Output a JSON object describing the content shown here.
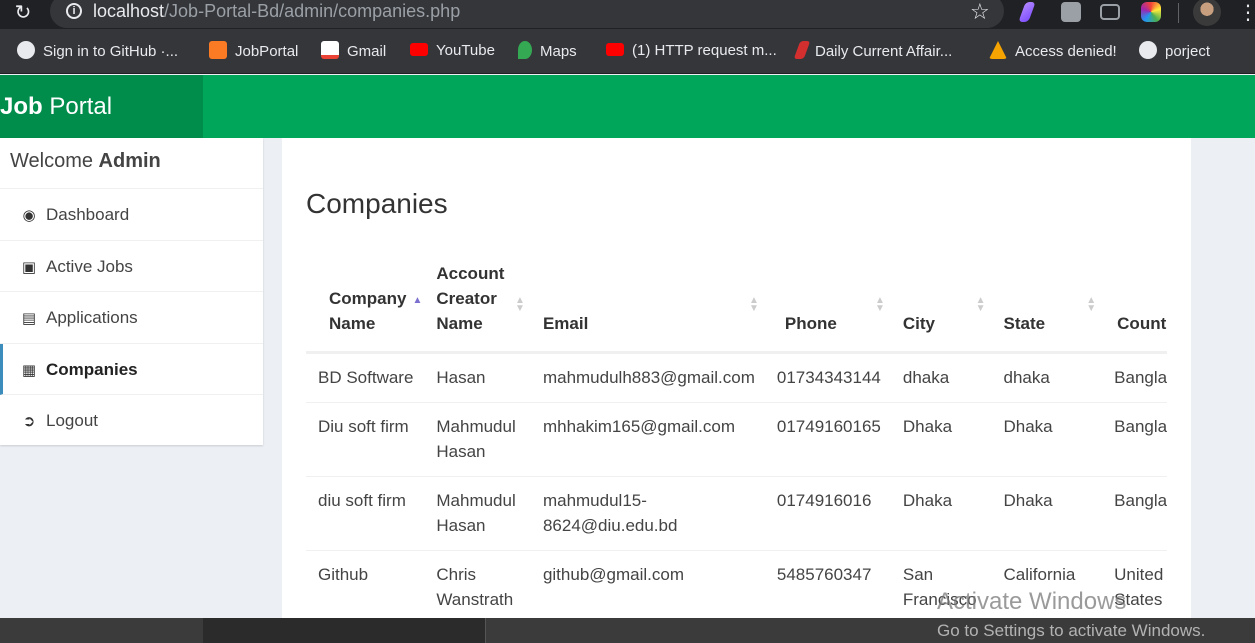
{
  "browser": {
    "url_host": "localhost",
    "url_path": "/Job-Portal-Bd/admin/companies.php",
    "bookmarks": [
      {
        "label": "Sign in to GitHub ·...",
        "icon": "github-icon",
        "color": "#ffffff"
      },
      {
        "label": "JobPortal",
        "icon": "xampp-icon",
        "color": "#fb7a24"
      },
      {
        "label": "Gmail",
        "icon": "gmail-icon",
        "color": "#ea4335"
      },
      {
        "label": "YouTube",
        "icon": "youtube-icon",
        "color": "#ff0000"
      },
      {
        "label": "Maps",
        "icon": "maps-icon",
        "color": "#34a853"
      },
      {
        "label": "(1) HTTP request m...",
        "icon": "youtube-icon",
        "color": "#ff0000"
      },
      {
        "label": "Daily Current Affair...",
        "icon": "daily-icon",
        "color": "#d32f2f"
      },
      {
        "label": "Access denied!",
        "icon": "access-icon",
        "color": "#f4a300"
      },
      {
        "label": "porject",
        "icon": "globe-icon",
        "color": "#e8eaed"
      }
    ]
  },
  "header": {
    "logo_bold": "Job",
    "logo_rest": " Portal"
  },
  "sidebar": {
    "welcome_prefix": "Welcome ",
    "welcome_user": "Admin",
    "items": [
      {
        "label": "Dashboard",
        "icon": "dashboard-icon"
      },
      {
        "label": "Active Jobs",
        "icon": "briefcase-icon"
      },
      {
        "label": "Applications",
        "icon": "id-card-icon"
      },
      {
        "label": "Companies",
        "icon": "building-icon"
      },
      {
        "label": "Logout",
        "icon": "logout-icon"
      }
    ]
  },
  "main": {
    "title": "Companies",
    "columns": [
      "Company Name",
      "Account Creator Name",
      "Email",
      "Phone",
      "City",
      "State",
      "Count"
    ],
    "rows": [
      [
        "BD Software",
        "Hasan",
        "mahmudulh883@gmail.com",
        "01734343144",
        "dhaka",
        "dhaka",
        "Banglac"
      ],
      [
        "Diu soft firm",
        "Mahmudul Hasan",
        "mhhakim165@gmail.com",
        "01749160165",
        "Dhaka",
        "Dhaka",
        "Banglac"
      ],
      [
        "diu soft firm",
        "Mahmudul Hasan",
        "mahmudul15-8624@diu.edu.bd",
        "0174916016",
        "Dhaka",
        "Dhaka",
        "Banglac"
      ],
      [
        "Github",
        "Chris Wanstrath",
        "github@gmail.com",
        "5485760347",
        "San Francisco",
        "California",
        "United States"
      ]
    ]
  },
  "watermark": {
    "line1": "Activate Windows",
    "line2": "Go to Settings to activate Windows."
  },
  "colors": {
    "header": "#00a65a",
    "logo_bg": "#008d4c",
    "active_border": "#3c8dbc"
  }
}
